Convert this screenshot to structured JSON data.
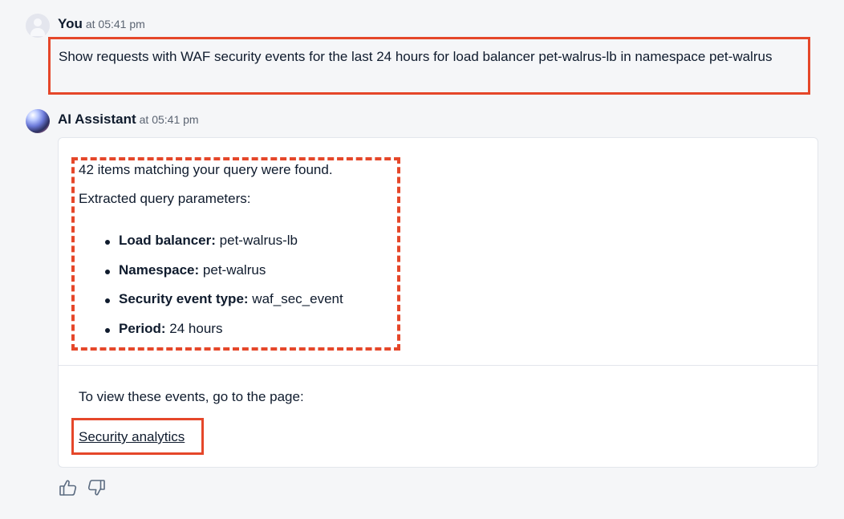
{
  "user_message": {
    "sender": "You",
    "time": "at 05:41 pm",
    "text": "Show requests with WAF security events for the last 24 hours for load balancer pet-walrus-lb in namespace pet-walrus"
  },
  "ai_message": {
    "sender": "AI Assistant",
    "time": "at 05:41 pm",
    "found_text": "42 items matching your query were found.",
    "params_heading": "Extracted query parameters:",
    "params": [
      {
        "key": "Load balancer:",
        "value": "pet-walrus-lb"
      },
      {
        "key": "Namespace:",
        "value": "pet-walrus"
      },
      {
        "key": "Security event type:",
        "value": "waf_sec_event"
      },
      {
        "key": "Period:",
        "value": "24 hours"
      }
    ],
    "view_text": "To view these events, go to the page:",
    "link_label": "Security analytics"
  },
  "feedback": {
    "like_icon": "thumbs-up-icon",
    "dislike_icon": "thumbs-down-icon"
  },
  "colors": {
    "highlight": "#e5472a",
    "text": "#0f1b2d",
    "background": "#f5f6f8"
  }
}
